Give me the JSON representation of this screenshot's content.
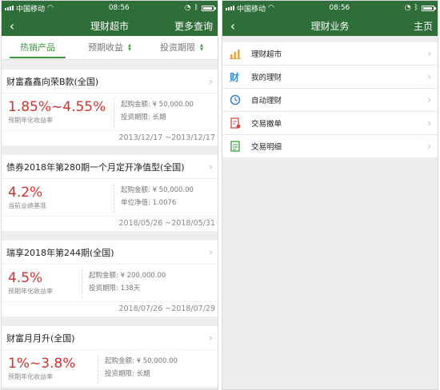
{
  "status": {
    "carrier": "中国移动",
    "time": "08:56"
  },
  "left_screen": {
    "title": "理财超市",
    "right_action": "更多查询",
    "filter_tabs": [
      "热销产品",
      "预期收益",
      "投资期限"
    ],
    "products": [
      {
        "name": "财富鑫鑫向荣B款(全国)",
        "rate": "1.85%~4.55%",
        "rate_label": "预期年化收益率",
        "min_amount": "起购金额: ¥ 50,000.00",
        "term": "投资期限: 长期",
        "dates": "2013/12/17 ~2013/12/17"
      },
      {
        "name": "债券2018年第280期一个月定开净值型(全国)",
        "rate": "4.2%",
        "rate_label": "当前业绩基准",
        "min_amount": "起购金额: ¥ 50,000.00",
        "term": "单位净值: 1.0076",
        "dates": "2018/05/26 ~2018/05/31"
      },
      {
        "name": "瑞享2018年第244期(全国)",
        "rate": "4.5%",
        "rate_label": "预期年化收益率",
        "min_amount": "起购金额: ¥ 200,000.00",
        "term": "投资期限: 138天",
        "dates": "2018/07/26 ~2018/07/29"
      },
      {
        "name": "财富月月升(全国)",
        "rate": "1%~3.8%",
        "rate_label": "预期年化收益率",
        "min_amount": "起购金额: ¥ 50,000.00",
        "term": "投资期限: 长期",
        "dates": ""
      }
    ]
  },
  "right_screen": {
    "title": "理财业务",
    "right_action": "主页",
    "menu": [
      {
        "label": "理财超市",
        "icon": "bar-chart-icon"
      },
      {
        "label": "我的理财",
        "icon": "wealth-icon"
      },
      {
        "label": "自动理财",
        "icon": "clock-icon"
      },
      {
        "label": "交易撤单",
        "icon": "cancel-doc-icon"
      },
      {
        "label": "交易明细",
        "icon": "detail-doc-icon"
      }
    ]
  },
  "colors": {
    "nav_green": "#2d6e39",
    "accent_green": "#3a9a3a",
    "rate_red": "#d0312d"
  }
}
